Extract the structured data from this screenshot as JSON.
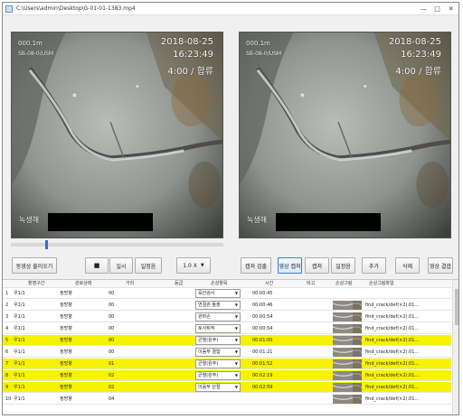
{
  "window": {
    "title": "C:\\Users\\admin\\Desktop\\G-01-01-1383.mp4",
    "min": "—",
    "max": "□",
    "close": "✕"
  },
  "video_left": {
    "code": "000.1m",
    "location": "SB-08-0/USM",
    "date": "2018-08-25",
    "time": "16:23:49",
    "flow": "4:00 / 합류",
    "bottom_label": "녹생해"
  },
  "video_right": {
    "code": "000.1m",
    "location": "SB-08-0/USM",
    "date": "2018-08-25",
    "time": "16:23:49",
    "flow": "4:00 / 합류",
    "bottom_label": "녹생해"
  },
  "progress": 0.16,
  "buttons": {
    "load_video": "동영상 불러오기",
    "stop": "■",
    "play": "▶",
    "pause": "일시",
    "end": "일정음",
    "speed": "1.0 X",
    "capture": "캡쳐 검출",
    "image_select": "영상 캡쳐",
    "capture2": "캡쳐",
    "pause2": "일정음",
    "add": "추가",
    "delete": "삭제",
    "save_load": "영상 결합"
  },
  "table": {
    "headers": [
      "번호",
      "촬영구간",
      "관로상태",
      "거리",
      "결과",
      "등급",
      "손상항목",
      "시간",
      "비고",
      "손상그림",
      "손상그림파일"
    ],
    "rows": [
      {
        "num": "1",
        "a": "우1/1",
        "b": "정방향",
        "c": "00",
        "d": "",
        "e": "",
        "sel": "육안검사",
        "time": "00:00:45",
        "highlight": false,
        "thumb": false,
        "file": ""
      },
      {
        "num": "2",
        "a": "우1/1",
        "b": "정방향",
        "c": "00",
        "d": "",
        "e": "",
        "sel": "연결관 돌출",
        "time": "00:00:46",
        "highlight": false,
        "thumb": true,
        "file": "find_crack/def(×2).01..."
      },
      {
        "num": "3",
        "a": "우1/1",
        "b": "정방향",
        "c": "00",
        "d": "",
        "e": "",
        "sel": "관파손",
        "time": "00:00:54",
        "highlight": false,
        "thumb": true,
        "file": "find_crack/def(×2).01..."
      },
      {
        "num": "4",
        "a": "우1/1",
        "b": "정방향",
        "c": "00",
        "d": "",
        "e": "",
        "sel": "토사퇴적",
        "time": "00:00:54",
        "highlight": false,
        "thumb": true,
        "file": "find_crack/def(×2).01..."
      },
      {
        "num": "5",
        "a": "우1/1",
        "b": "정방향",
        "c": "00",
        "d": "",
        "e": "",
        "sel": "균열(원주)",
        "time": "00:01:00",
        "highlight": true,
        "thumb": true,
        "file": "find_crack/def(×2).01..."
      },
      {
        "num": "6",
        "a": "우1/1",
        "b": "정방향",
        "c": "00",
        "d": "",
        "e": "",
        "sel": "이음부 결함",
        "time": "00:01:21",
        "highlight": false,
        "thumb": true,
        "file": "find_crack/def(×2).01..."
      },
      {
        "num": "7",
        "a": "우1/1",
        "b": "정방향",
        "c": "01",
        "d": "",
        "e": "",
        "sel": "균열(원주)",
        "time": "00:01:52",
        "highlight": true,
        "thumb": true,
        "file": "find_crack/def(×2).01..."
      },
      {
        "num": "8",
        "a": "우1/1",
        "b": "정방향",
        "c": "02",
        "d": "",
        "e": "",
        "sel": "균열(원주)",
        "time": "00:02:19",
        "highlight": true,
        "thumb": true,
        "file": "find_crack/def(×2).01..."
      },
      {
        "num": "9",
        "a": "우1/1",
        "b": "정방향",
        "c": "02",
        "d": "",
        "e": "",
        "sel": "이음부 단절",
        "time": "00:02:59",
        "highlight": true,
        "thumb": true,
        "file": "find_crack/def(×2).01..."
      },
      {
        "num": "10",
        "a": "우1/1",
        "b": "정방향",
        "c": "04",
        "d": "",
        "e": "",
        "sel": "",
        "time": "",
        "highlight": false,
        "thumb": true,
        "file": "find_crack/def(×2).01..."
      }
    ]
  }
}
